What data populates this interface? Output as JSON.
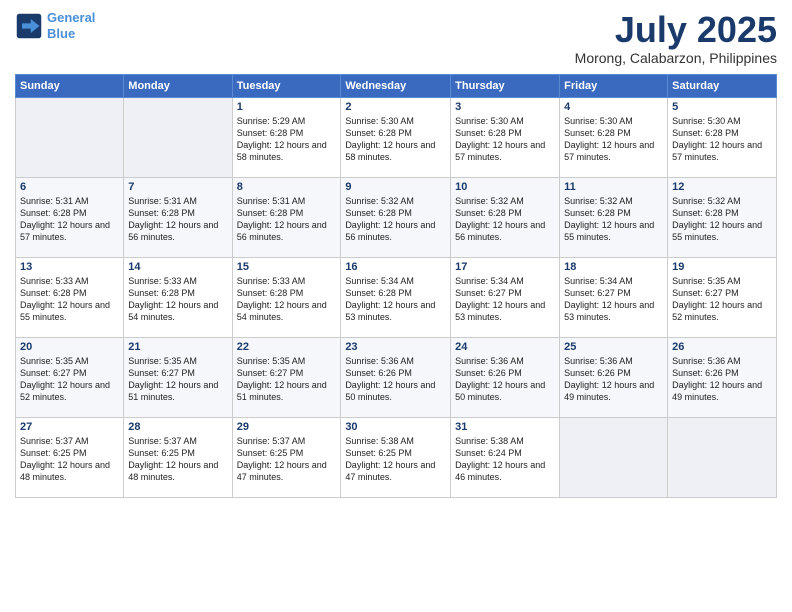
{
  "logo": {
    "line1": "General",
    "line2": "Blue"
  },
  "title": "July 2025",
  "location": "Morong, Calabarzon, Philippines",
  "weekdays": [
    "Sunday",
    "Monday",
    "Tuesday",
    "Wednesday",
    "Thursday",
    "Friday",
    "Saturday"
  ],
  "weeks": [
    [
      {
        "day": "",
        "sunrise": "",
        "sunset": "",
        "daylight": ""
      },
      {
        "day": "",
        "sunrise": "",
        "sunset": "",
        "daylight": ""
      },
      {
        "day": "1",
        "sunrise": "Sunrise: 5:29 AM",
        "sunset": "Sunset: 6:28 PM",
        "daylight": "Daylight: 12 hours and 58 minutes."
      },
      {
        "day": "2",
        "sunrise": "Sunrise: 5:30 AM",
        "sunset": "Sunset: 6:28 PM",
        "daylight": "Daylight: 12 hours and 58 minutes."
      },
      {
        "day": "3",
        "sunrise": "Sunrise: 5:30 AM",
        "sunset": "Sunset: 6:28 PM",
        "daylight": "Daylight: 12 hours and 57 minutes."
      },
      {
        "day": "4",
        "sunrise": "Sunrise: 5:30 AM",
        "sunset": "Sunset: 6:28 PM",
        "daylight": "Daylight: 12 hours and 57 minutes."
      },
      {
        "day": "5",
        "sunrise": "Sunrise: 5:30 AM",
        "sunset": "Sunset: 6:28 PM",
        "daylight": "Daylight: 12 hours and 57 minutes."
      }
    ],
    [
      {
        "day": "6",
        "sunrise": "Sunrise: 5:31 AM",
        "sunset": "Sunset: 6:28 PM",
        "daylight": "Daylight: 12 hours and 57 minutes."
      },
      {
        "day": "7",
        "sunrise": "Sunrise: 5:31 AM",
        "sunset": "Sunset: 6:28 PM",
        "daylight": "Daylight: 12 hours and 56 minutes."
      },
      {
        "day": "8",
        "sunrise": "Sunrise: 5:31 AM",
        "sunset": "Sunset: 6:28 PM",
        "daylight": "Daylight: 12 hours and 56 minutes."
      },
      {
        "day": "9",
        "sunrise": "Sunrise: 5:32 AM",
        "sunset": "Sunset: 6:28 PM",
        "daylight": "Daylight: 12 hours and 56 minutes."
      },
      {
        "day": "10",
        "sunrise": "Sunrise: 5:32 AM",
        "sunset": "Sunset: 6:28 PM",
        "daylight": "Daylight: 12 hours and 56 minutes."
      },
      {
        "day": "11",
        "sunrise": "Sunrise: 5:32 AM",
        "sunset": "Sunset: 6:28 PM",
        "daylight": "Daylight: 12 hours and 55 minutes."
      },
      {
        "day": "12",
        "sunrise": "Sunrise: 5:32 AM",
        "sunset": "Sunset: 6:28 PM",
        "daylight": "Daylight: 12 hours and 55 minutes."
      }
    ],
    [
      {
        "day": "13",
        "sunrise": "Sunrise: 5:33 AM",
        "sunset": "Sunset: 6:28 PM",
        "daylight": "Daylight: 12 hours and 55 minutes."
      },
      {
        "day": "14",
        "sunrise": "Sunrise: 5:33 AM",
        "sunset": "Sunset: 6:28 PM",
        "daylight": "Daylight: 12 hours and 54 minutes."
      },
      {
        "day": "15",
        "sunrise": "Sunrise: 5:33 AM",
        "sunset": "Sunset: 6:28 PM",
        "daylight": "Daylight: 12 hours and 54 minutes."
      },
      {
        "day": "16",
        "sunrise": "Sunrise: 5:34 AM",
        "sunset": "Sunset: 6:28 PM",
        "daylight": "Daylight: 12 hours and 53 minutes."
      },
      {
        "day": "17",
        "sunrise": "Sunrise: 5:34 AM",
        "sunset": "Sunset: 6:27 PM",
        "daylight": "Daylight: 12 hours and 53 minutes."
      },
      {
        "day": "18",
        "sunrise": "Sunrise: 5:34 AM",
        "sunset": "Sunset: 6:27 PM",
        "daylight": "Daylight: 12 hours and 53 minutes."
      },
      {
        "day": "19",
        "sunrise": "Sunrise: 5:35 AM",
        "sunset": "Sunset: 6:27 PM",
        "daylight": "Daylight: 12 hours and 52 minutes."
      }
    ],
    [
      {
        "day": "20",
        "sunrise": "Sunrise: 5:35 AM",
        "sunset": "Sunset: 6:27 PM",
        "daylight": "Daylight: 12 hours and 52 minutes."
      },
      {
        "day": "21",
        "sunrise": "Sunrise: 5:35 AM",
        "sunset": "Sunset: 6:27 PM",
        "daylight": "Daylight: 12 hours and 51 minutes."
      },
      {
        "day": "22",
        "sunrise": "Sunrise: 5:35 AM",
        "sunset": "Sunset: 6:27 PM",
        "daylight": "Daylight: 12 hours and 51 minutes."
      },
      {
        "day": "23",
        "sunrise": "Sunrise: 5:36 AM",
        "sunset": "Sunset: 6:26 PM",
        "daylight": "Daylight: 12 hours and 50 minutes."
      },
      {
        "day": "24",
        "sunrise": "Sunrise: 5:36 AM",
        "sunset": "Sunset: 6:26 PM",
        "daylight": "Daylight: 12 hours and 50 minutes."
      },
      {
        "day": "25",
        "sunrise": "Sunrise: 5:36 AM",
        "sunset": "Sunset: 6:26 PM",
        "daylight": "Daylight: 12 hours and 49 minutes."
      },
      {
        "day": "26",
        "sunrise": "Sunrise: 5:36 AM",
        "sunset": "Sunset: 6:26 PM",
        "daylight": "Daylight: 12 hours and 49 minutes."
      }
    ],
    [
      {
        "day": "27",
        "sunrise": "Sunrise: 5:37 AM",
        "sunset": "Sunset: 6:25 PM",
        "daylight": "Daylight: 12 hours and 48 minutes."
      },
      {
        "day": "28",
        "sunrise": "Sunrise: 5:37 AM",
        "sunset": "Sunset: 6:25 PM",
        "daylight": "Daylight: 12 hours and 48 minutes."
      },
      {
        "day": "29",
        "sunrise": "Sunrise: 5:37 AM",
        "sunset": "Sunset: 6:25 PM",
        "daylight": "Daylight: 12 hours and 47 minutes."
      },
      {
        "day": "30",
        "sunrise": "Sunrise: 5:38 AM",
        "sunset": "Sunset: 6:25 PM",
        "daylight": "Daylight: 12 hours and 47 minutes."
      },
      {
        "day": "31",
        "sunrise": "Sunrise: 5:38 AM",
        "sunset": "Sunset: 6:24 PM",
        "daylight": "Daylight: 12 hours and 46 minutes."
      },
      {
        "day": "",
        "sunrise": "",
        "sunset": "",
        "daylight": ""
      },
      {
        "day": "",
        "sunrise": "",
        "sunset": "",
        "daylight": ""
      }
    ]
  ]
}
